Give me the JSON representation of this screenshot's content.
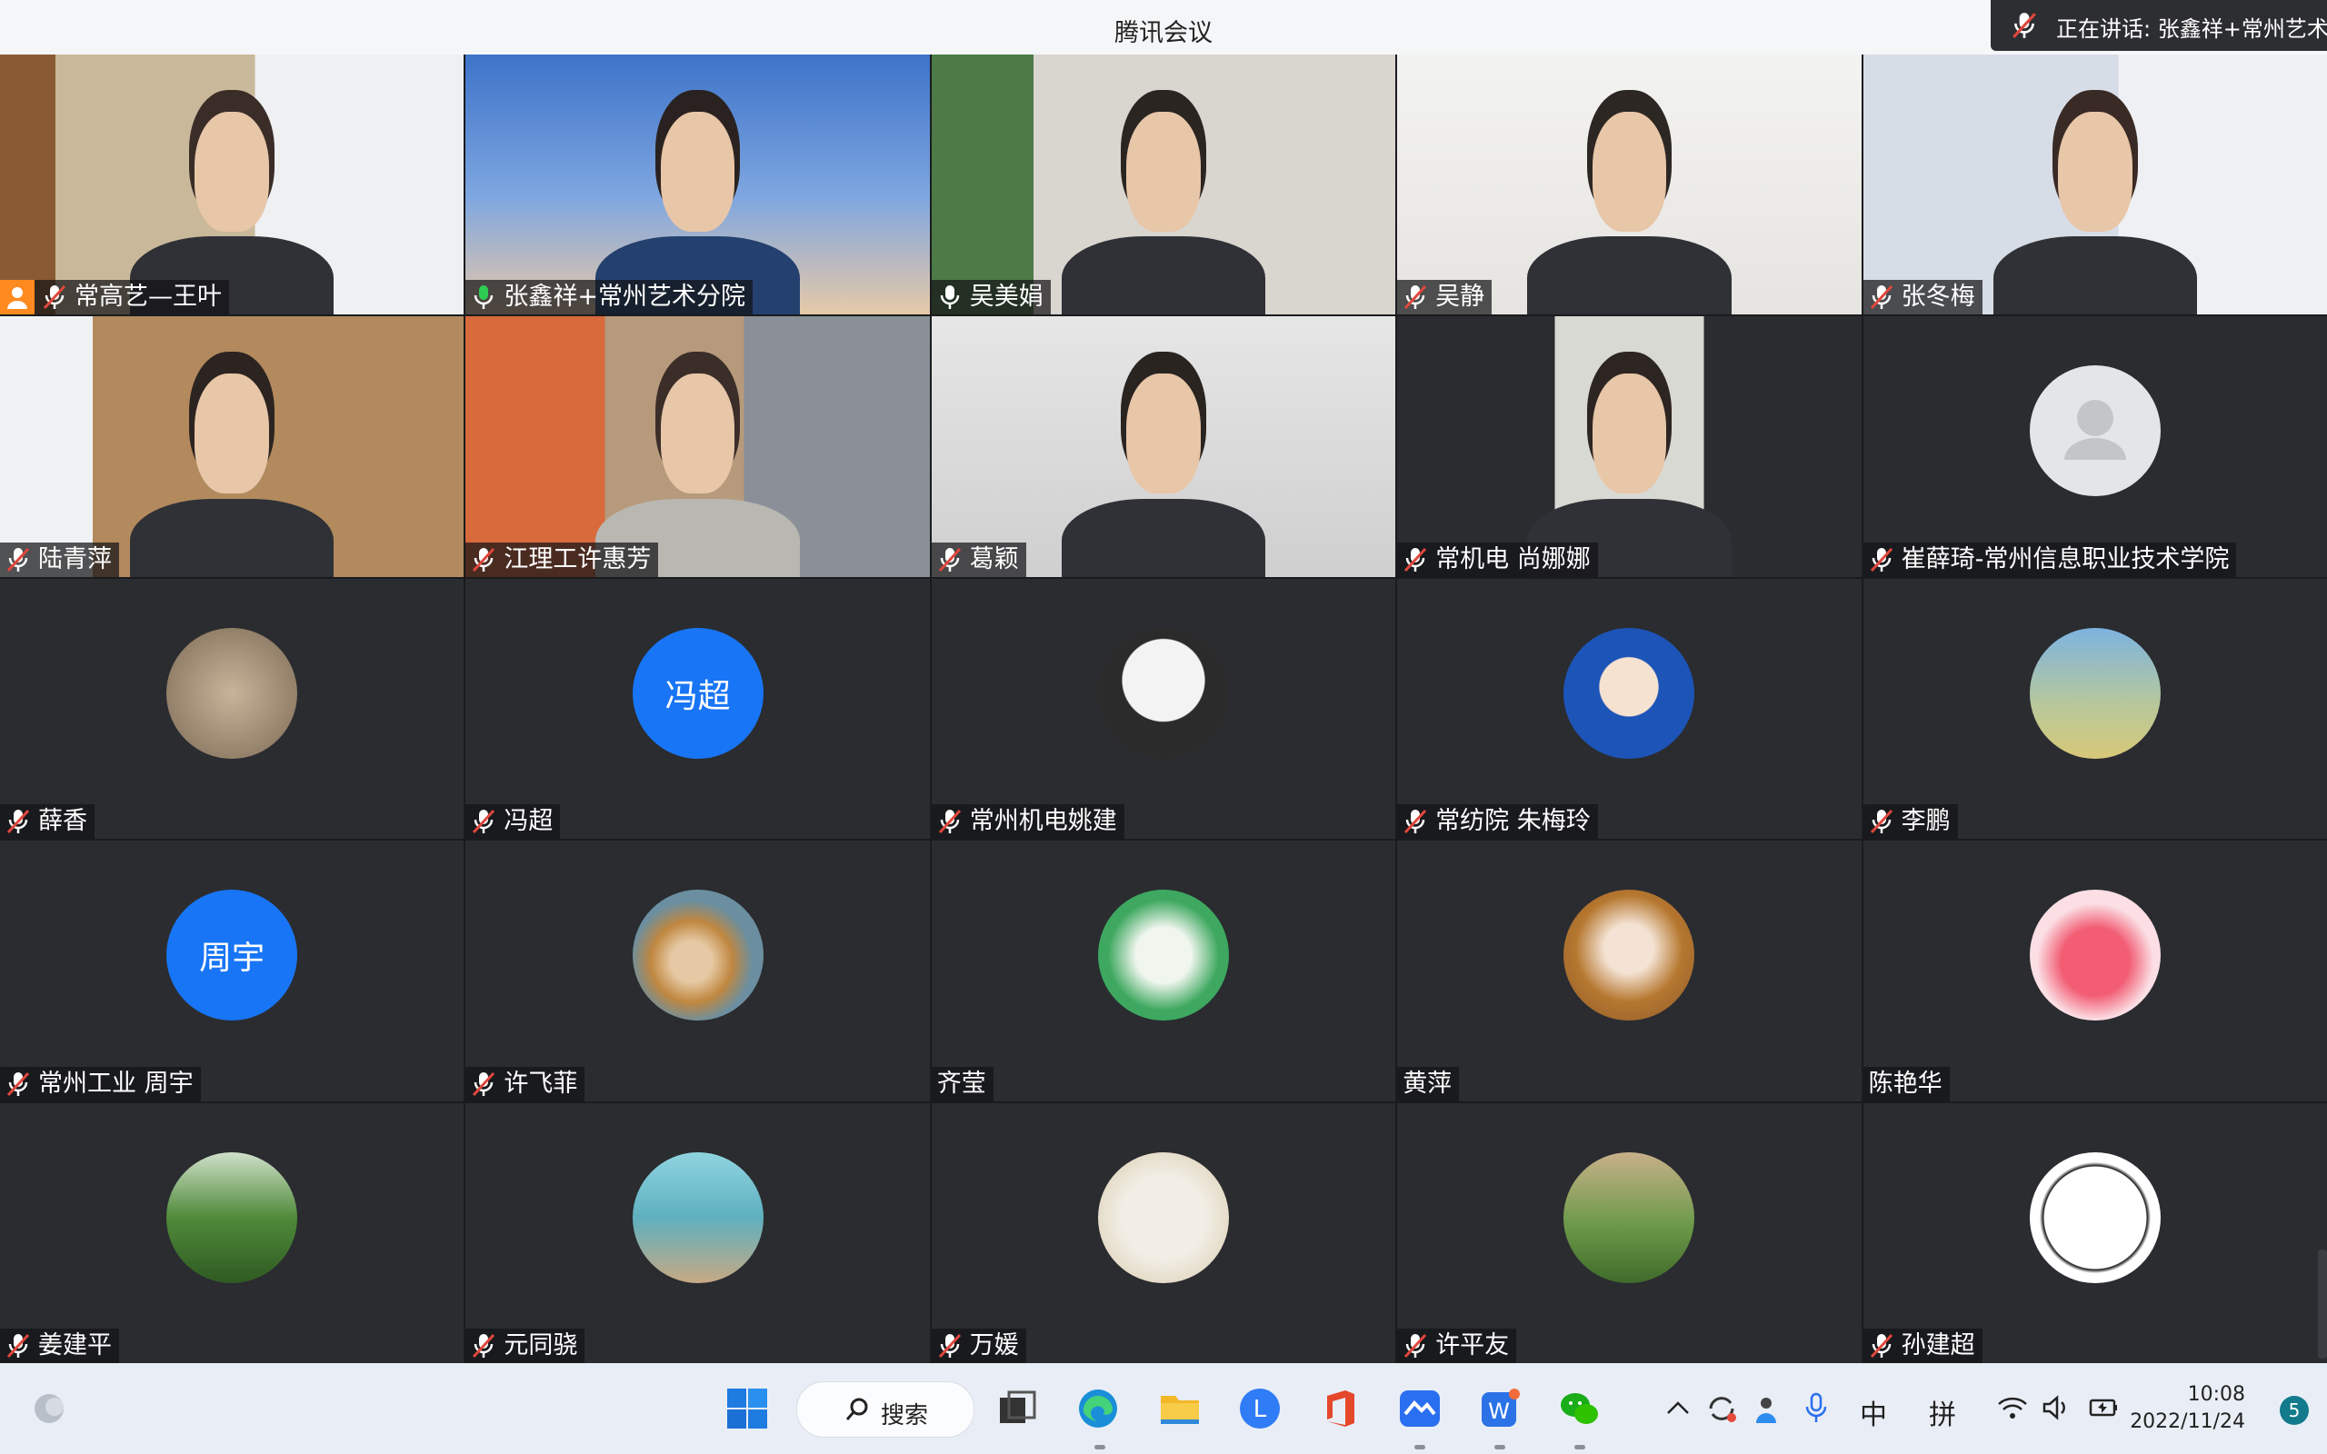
{
  "window": {
    "title": "腾讯会议",
    "speaking_label": "正在讲话: 张鑫祥+常州艺术"
  },
  "participants": [
    {
      "name": "常高艺—王叶",
      "mic": "muted",
      "kind": "video",
      "host": true
    },
    {
      "name": "张鑫祥+常州艺术分院",
      "mic": "active",
      "kind": "video"
    },
    {
      "name": "吴美娟",
      "mic": "on",
      "kind": "video"
    },
    {
      "name": "吴静",
      "mic": "muted",
      "kind": "video"
    },
    {
      "name": "张冬梅",
      "mic": "muted",
      "kind": "video"
    },
    {
      "name": "陆青萍",
      "mic": "muted",
      "kind": "video"
    },
    {
      "name": "江理工许惠芳",
      "mic": "muted",
      "kind": "video"
    },
    {
      "name": "葛颖",
      "mic": "muted",
      "kind": "video"
    },
    {
      "name": "常机电 尚娜娜",
      "mic": "muted",
      "kind": "video"
    },
    {
      "name": "崔薛琦-常州信息职业技术学院",
      "mic": "muted",
      "kind": "default-avatar"
    },
    {
      "name": "薛香",
      "mic": "muted",
      "kind": "avatar"
    },
    {
      "name": "冯超",
      "mic": "muted",
      "kind": "text-avatar",
      "avatar_text": "冯超"
    },
    {
      "name": "常州机电姚建",
      "mic": "muted",
      "kind": "avatar"
    },
    {
      "name": "常纺院 朱梅玲",
      "mic": "muted",
      "kind": "avatar"
    },
    {
      "name": "李鹏",
      "mic": "muted",
      "kind": "avatar"
    },
    {
      "name": "常州工业 周宇",
      "mic": "muted",
      "kind": "text-avatar",
      "avatar_text": "周宇"
    },
    {
      "name": "许飞菲",
      "mic": "muted",
      "kind": "avatar"
    },
    {
      "name": "齐莹",
      "mic": "none",
      "kind": "avatar"
    },
    {
      "name": "黄萍",
      "mic": "none",
      "kind": "avatar"
    },
    {
      "name": "陈艳华",
      "mic": "none",
      "kind": "avatar"
    },
    {
      "name": "姜建平",
      "mic": "muted",
      "kind": "avatar"
    },
    {
      "name": "元同骁",
      "mic": "muted",
      "kind": "avatar"
    },
    {
      "name": "万媛",
      "mic": "muted",
      "kind": "avatar"
    },
    {
      "name": "许平友",
      "mic": "muted",
      "kind": "avatar"
    },
    {
      "name": "孙建超",
      "mic": "muted",
      "kind": "avatar"
    }
  ],
  "taskbar": {
    "search_label": "搜索",
    "ime_lang": "中",
    "ime_mode": "拼",
    "time": "10:08",
    "date": "2022/11/24",
    "notification_count": "5"
  },
  "colors": {
    "mic_muted": "#e0473c",
    "mic_active": "#2ecc52",
    "avatar_blue": "#1875f5",
    "host_badge": "#ff8a1f"
  }
}
